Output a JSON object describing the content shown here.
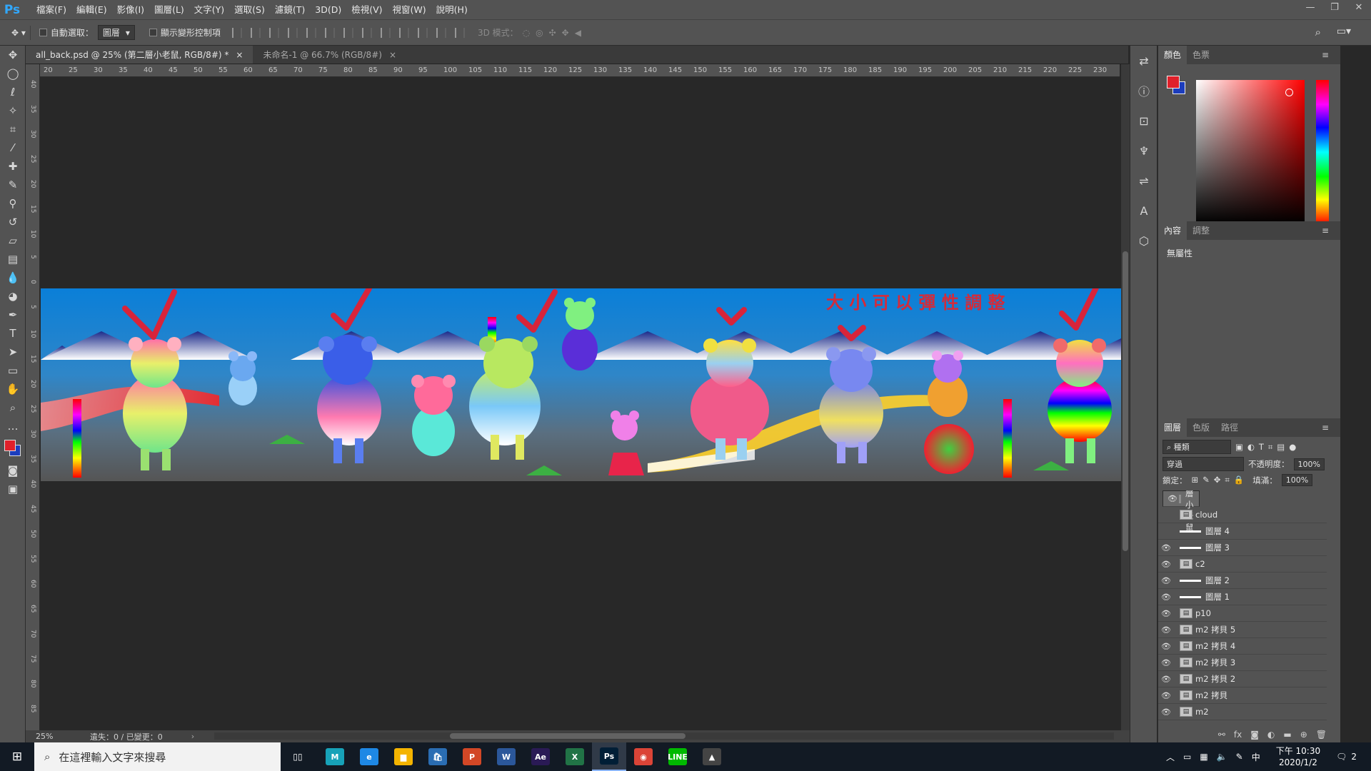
{
  "app": {
    "logo": "Ps",
    "menus": [
      "檔案(F)",
      "編輯(E)",
      "影像(I)",
      "圖層(L)",
      "文字(Y)",
      "選取(S)",
      "濾鏡(T)",
      "3D(D)",
      "檢視(V)",
      "視窗(W)",
      "說明(H)"
    ]
  },
  "options": {
    "auto_select": "自動選取：",
    "target": "圖層",
    "show_transform": "顯示變形控制項",
    "mode3d": "3D 模式："
  },
  "tabs": [
    {
      "label": "all_back.psd @ 25% (第二層小老鼠, RGB/8#) *"
    },
    {
      "label": "未命名-1 @ 66.7% (RGB/8#)"
    }
  ],
  "ruler_h": [
    "20",
    "25",
    "30",
    "35",
    "40",
    "45",
    "50",
    "55",
    "60",
    "65",
    "70",
    "75",
    "80",
    "85",
    "90",
    "95",
    "100",
    "105",
    "110",
    "115",
    "120",
    "125",
    "130",
    "135",
    "140",
    "145",
    "150",
    "155",
    "160",
    "165",
    "170",
    "175",
    "180",
    "185",
    "190",
    "195",
    "200",
    "205",
    "210",
    "215",
    "220",
    "225",
    "230"
  ],
  "ruler_v": [
    "40",
    "35",
    "30",
    "25",
    "20",
    "15",
    "10",
    "5",
    "0",
    "5",
    "10",
    "15",
    "20",
    "25",
    "30",
    "35",
    "40",
    "45",
    "50",
    "55",
    "60",
    "65",
    "70",
    "75",
    "80",
    "85"
  ],
  "artwork": {
    "text": "大 小 可 以 彈 性 調 整",
    "text_color": "#d42b3a",
    "sky": "#0a7fd8"
  },
  "status": {
    "zoom": "25%",
    "info": "遺失：0 / 已變更：0"
  },
  "color_panel": {
    "tabs": [
      "顏色",
      "色票"
    ],
    "fg": "#e0202a",
    "bg": "#1c3dbd"
  },
  "props_panel": {
    "tabs": [
      "內容",
      "調整"
    ],
    "text": "無屬性"
  },
  "layers_panel": {
    "tabs": [
      "圖層",
      "色版",
      "路徑"
    ],
    "filter": "種類",
    "blend": "穿過",
    "opacity_label": "不透明度：",
    "opacity": "100%",
    "lock_label": "鎖定：",
    "fill_label": "填滿：",
    "fill": "100%",
    "layers": [
      {
        "name": "第二層小老鼠",
        "visible": true,
        "kind": "folder"
      },
      {
        "name": "cloud",
        "visible": false,
        "kind": "smart"
      },
      {
        "name": "圖層 4",
        "visible": false,
        "kind": "line"
      },
      {
        "name": "圖層 3",
        "visible": true,
        "kind": "line"
      },
      {
        "name": "c2",
        "visible": true,
        "kind": "smart"
      },
      {
        "name": "圖層 2",
        "visible": true,
        "kind": "line"
      },
      {
        "name": "圖層 1",
        "visible": true,
        "kind": "line"
      },
      {
        "name": "p10",
        "visible": true,
        "kind": "smart"
      },
      {
        "name": "m2 拷貝 5",
        "visible": true,
        "kind": "smart"
      },
      {
        "name": "m2 拷貝 4",
        "visible": true,
        "kind": "smart"
      },
      {
        "name": "m2 拷貝 3",
        "visible": true,
        "kind": "smart"
      },
      {
        "name": "m2 拷貝 2",
        "visible": true,
        "kind": "smart"
      },
      {
        "name": "m2 拷貝",
        "visible": true,
        "kind": "smart"
      },
      {
        "name": "m2",
        "visible": true,
        "kind": "smart"
      }
    ]
  },
  "taskbar": {
    "search_placeholder": "在這裡輸入文字來搜尋",
    "apps": [
      {
        "label": "M",
        "color": "#17a2b8"
      },
      {
        "label": "e",
        "color": "#1e88e5"
      },
      {
        "label": "▆",
        "color": "#f4b400"
      },
      {
        "label": "🛍",
        "color": "#2a6db3"
      },
      {
        "label": "P",
        "color": "#d24726"
      },
      {
        "label": "W",
        "color": "#2b579a"
      },
      {
        "label": "Ae",
        "color": "#2a1a55"
      },
      {
        "label": "X",
        "color": "#217346"
      },
      {
        "label": "Ps",
        "color": "#001e36"
      },
      {
        "label": "◉",
        "color": "#db4437"
      },
      {
        "label": "LINE",
        "color": "#00b900"
      },
      {
        "label": "▲",
        "color": "#444"
      }
    ],
    "ime": "中",
    "time": "下午 10:30",
    "date": "2020/1/2",
    "notif": "2"
  }
}
